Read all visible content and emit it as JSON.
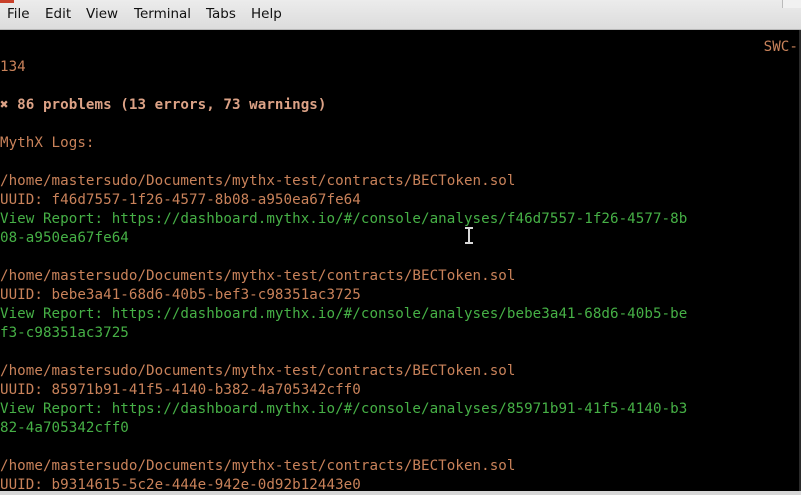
{
  "menu": {
    "items": [
      "File",
      "Edit",
      "View",
      "Terminal",
      "Tabs",
      "Help"
    ]
  },
  "terminal": {
    "swc_fragment": "SWC-",
    "lines": [
      {
        "text": "134",
        "style": "orange"
      },
      {
        "text": "✖ 86 problems (13 errors, 73 warnings)",
        "style": "bold"
      },
      {
        "text": "MythX Logs:",
        "style": "orange"
      },
      {
        "text": "/home/mastersudo/Documents/mythx-test/contracts/BECToken.sol",
        "style": "orange"
      },
      {
        "text": "UUID: f46d7557-1f26-4577-8b08-a950ea67fe64",
        "style": "orange"
      },
      {
        "text": "View Report: https://dashboard.mythx.io/#/console/analyses/f46d7557-1f26-4577-8b",
        "style": "green"
      },
      {
        "text": "08-a950ea67fe64",
        "style": "green"
      },
      {
        "text": "/home/mastersudo/Documents/mythx-test/contracts/BECToken.sol",
        "style": "orange"
      },
      {
        "text": "UUID: bebe3a41-68d6-40b5-bef3-c98351ac3725",
        "style": "orange"
      },
      {
        "text": "View Report: https://dashboard.mythx.io/#/console/analyses/bebe3a41-68d6-40b5-be",
        "style": "green"
      },
      {
        "text": "f3-c98351ac3725",
        "style": "green"
      },
      {
        "text": "/home/mastersudo/Documents/mythx-test/contracts/BECToken.sol",
        "style": "orange"
      },
      {
        "text": "UUID: 85971b91-41f5-4140-b382-4a705342cff0",
        "style": "orange"
      },
      {
        "text": "View Report: https://dashboard.mythx.io/#/console/analyses/85971b91-41f5-4140-b3",
        "style": "green"
      },
      {
        "text": "82-4a705342cff0",
        "style": "green"
      },
      {
        "text": "/home/mastersudo/Documents/mythx-test/contracts/BECToken.sol",
        "style": "orange"
      },
      {
        "text": "UUID: b9314615-5c2e-444e-942e-0d92b12443e0",
        "style": "orange"
      }
    ]
  },
  "colors": {
    "terminal_bg": "#000000",
    "text_orange": "#c9825a",
    "text_green": "#46b046",
    "text_bold": "#dca286",
    "menubar_bg": "#e4e4e4"
  }
}
